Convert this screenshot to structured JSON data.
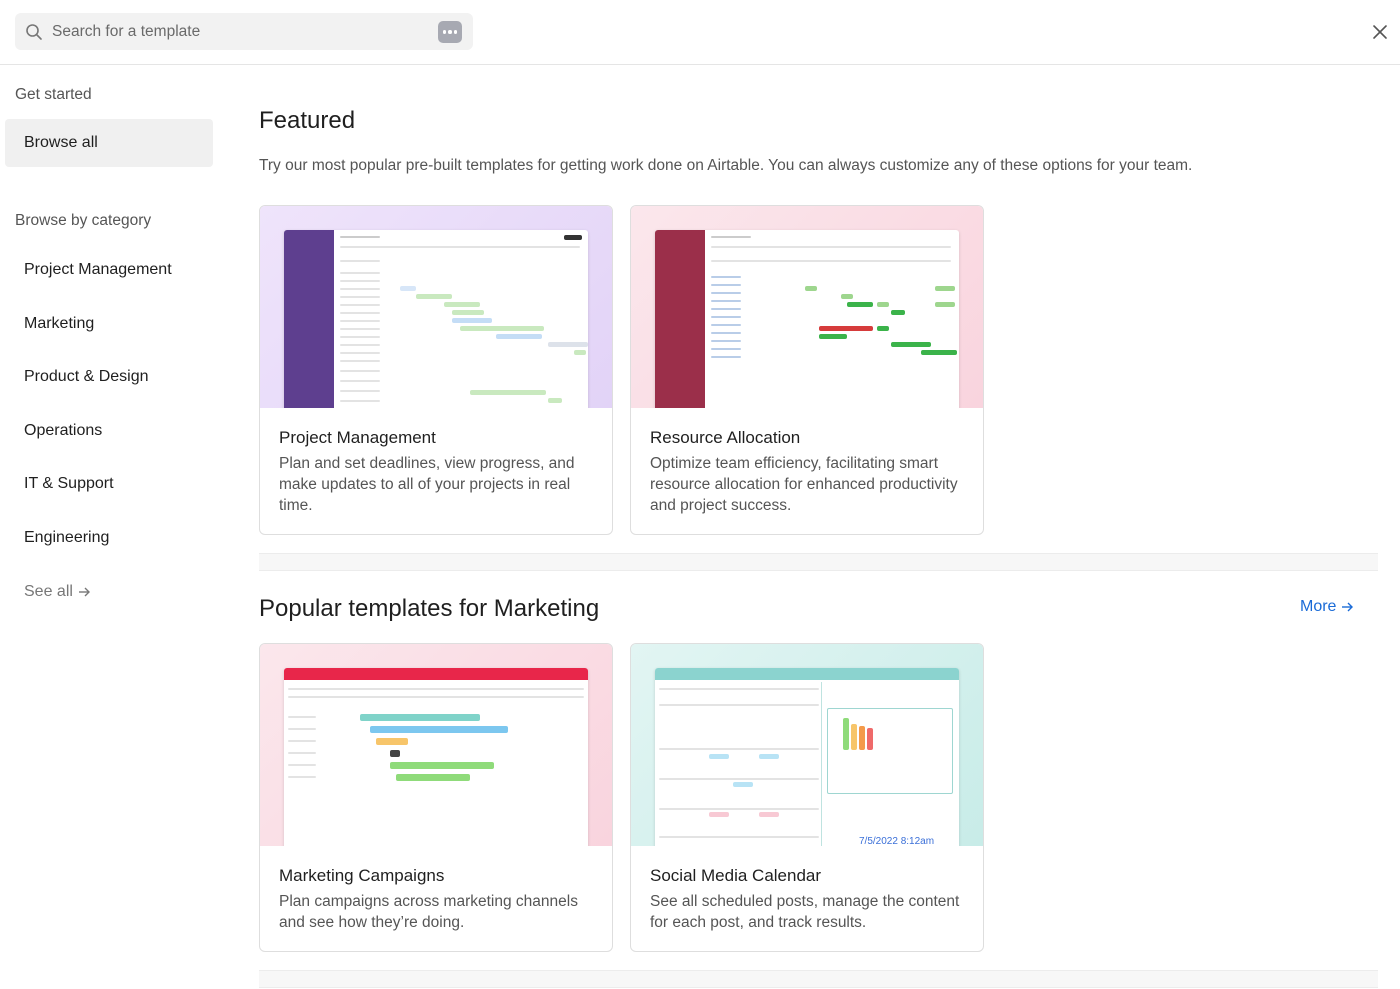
{
  "search": {
    "placeholder": "Search for a template",
    "icon": "search-icon",
    "more_icon": "more-dots-icon"
  },
  "close_icon": "close-icon",
  "sidebar": {
    "get_started_heading": "Get started",
    "browse_all": "Browse all",
    "category_heading": "Browse by category",
    "categories": [
      {
        "label": "Project Management"
      },
      {
        "label": "Marketing"
      },
      {
        "label": "Product & Design"
      },
      {
        "label": "Operations"
      },
      {
        "label": "IT & Support"
      },
      {
        "label": "Engineering"
      }
    ],
    "see_all": "See all"
  },
  "featured": {
    "heading": "Featured",
    "subtitle": "Try our most popular pre-built templates for getting work done on Airtable. You can always customize any of these options for your team.",
    "cards": [
      {
        "title": "Project Management",
        "description": "Plan and set deadlines, view progress, and make updates to all of your projects in real time."
      },
      {
        "title": "Resource Allocation",
        "description": "Optimize team efficiency, facilitating smart resource allocation for enhanced productivity and project success."
      }
    ]
  },
  "marketing": {
    "heading": "Popular templates for Marketing",
    "more": "More",
    "cards": [
      {
        "title": "Marketing Campaigns",
        "description": "Plan campaigns across marketing channels and see how they’re doing."
      },
      {
        "title": "Social Media Calendar",
        "description": "See all scheduled posts, manage the content for each post, and track results.",
        "thumb_date": "7/5/2022 8:12am"
      }
    ]
  },
  "colors": {
    "accent_link": "#1a6bd7",
    "pm_sidebar": "#5e3f8f",
    "ra_sidebar": "#9b2f4a",
    "mc_header": "#e8264a",
    "smc_header": "#8bd3cf"
  }
}
